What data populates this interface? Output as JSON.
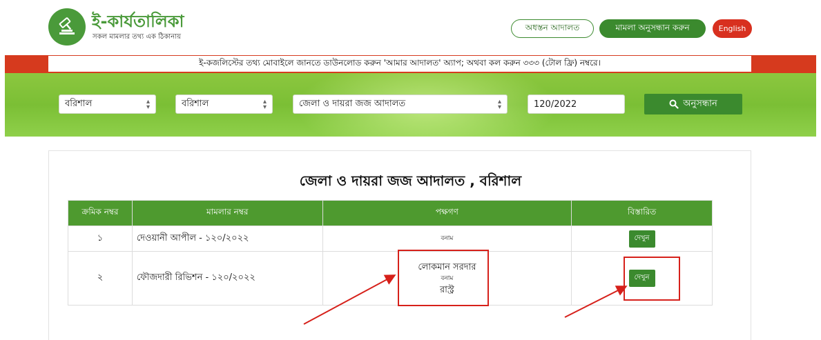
{
  "header": {
    "logo_title": "ই-কার্যতালিকা",
    "logo_subtitle": "সকল মামলার তথ্য এক ঠিকানায়",
    "lower_court_button": "অধস্তন আদালত",
    "case_search_button": "মামলা অনুসন্ধান করুন",
    "language_button": "English"
  },
  "notice": {
    "text": "ই-কজলিস্টের তথ্য মোবাইলে জানতে ডাউনলোড করুন 'আমার আদালত' অ্যাপ; অথবা কল করুন ৩৩৩ (টোল ফ্রি) নম্বরে।"
  },
  "search": {
    "division_selected": "বরিশাল",
    "district_selected": "বরিশাল",
    "court_selected": "জেলা ও দায়রা জজ আদালত",
    "case_number_value": "120/2022",
    "search_button": "অনুসন্ধান"
  },
  "court_title": "জেলা ও দায়রা জজ আদালত , বরিশাল",
  "table": {
    "headers": [
      "ক্রমিক নম্বর",
      "মামলার নম্বর",
      "পক্ষগণ",
      "বিস্তারিত"
    ],
    "rows": [
      {
        "serial": "১",
        "case": "দেওয়ানী আপীল - ১২০/২০২২",
        "party1": "",
        "versus": "বনাম",
        "party2": "",
        "detail": "দেখুন"
      },
      {
        "serial": "২",
        "case": "ফৌজদারী রিভিশন - ১২০/২০২২",
        "party1": "লোকমান সরদার",
        "versus": "বনাম",
        "party2": "রাস্ট্র",
        "detail": "দেখুন"
      }
    ]
  },
  "colors": {
    "brand_green": "#3b8a2e",
    "header_green": "#4e9a2f",
    "notice_red": "#d63a1e",
    "english_red": "#d8301f",
    "annotation_red": "#d6201a"
  },
  "icons": [
    "gavel-icon",
    "search-icon",
    "select-arrows-icon"
  ]
}
